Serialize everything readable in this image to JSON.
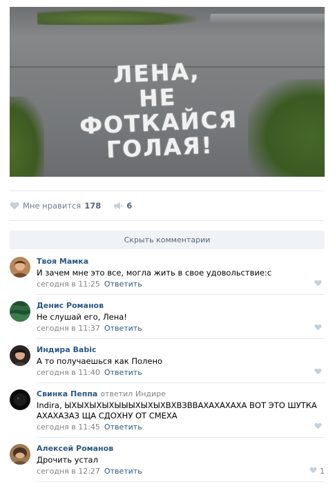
{
  "post": {
    "photo_text": [
      "ЛЕНА,",
      "НЕ",
      "ФОТКАЙСЯ",
      "ГОЛАЯ!"
    ],
    "like_label": "Мне нравится",
    "like_count": "178",
    "share_count": "6"
  },
  "comments_section": {
    "hide_label": "Скрыть комментарии"
  },
  "comments": [
    {
      "author": "Твоя Мамка",
      "text": "И зачем мне это все, могла жить в свое удовольствие:с",
      "time": "сегодня в 11:25",
      "reply_label": "Ответить",
      "likes": ""
    },
    {
      "author": "Денис Романов",
      "text": "Не слушай его, Лена!",
      "time": "сегодня в 11:37",
      "reply_label": "Ответить",
      "likes": ""
    },
    {
      "author": "Индира Babic",
      "text": "А то получаешься как Полено",
      "time": "сегодня в 11:40",
      "reply_label": "Ответить",
      "likes": ""
    },
    {
      "author": "Свинка Пеппа",
      "reply_to_label": "ответил",
      "reply_to_name": "Индире",
      "text": "Indira, ЫХЫХЫХЫХЫЫЫХЫХЫХВХВЗВВАХАХАХАХА ВОТ ЭТО ШУТКА АХАХАЗАЗ ЩА СДОХНУ ОТ СМЕХА",
      "time": "сегодня в 11:45",
      "reply_label": "Ответить",
      "likes": ""
    },
    {
      "author": "Алексей Романов",
      "text": "Дрочить устал",
      "time": "сегодня в 12:27",
      "reply_label": "Ответить",
      "likes": "1"
    }
  ],
  "colors": {
    "link": "#2a5885",
    "muted": "#828282",
    "icon": "#b6c2cf",
    "separator": "#e7e8ec",
    "button_bg": "#f0f2f5"
  }
}
